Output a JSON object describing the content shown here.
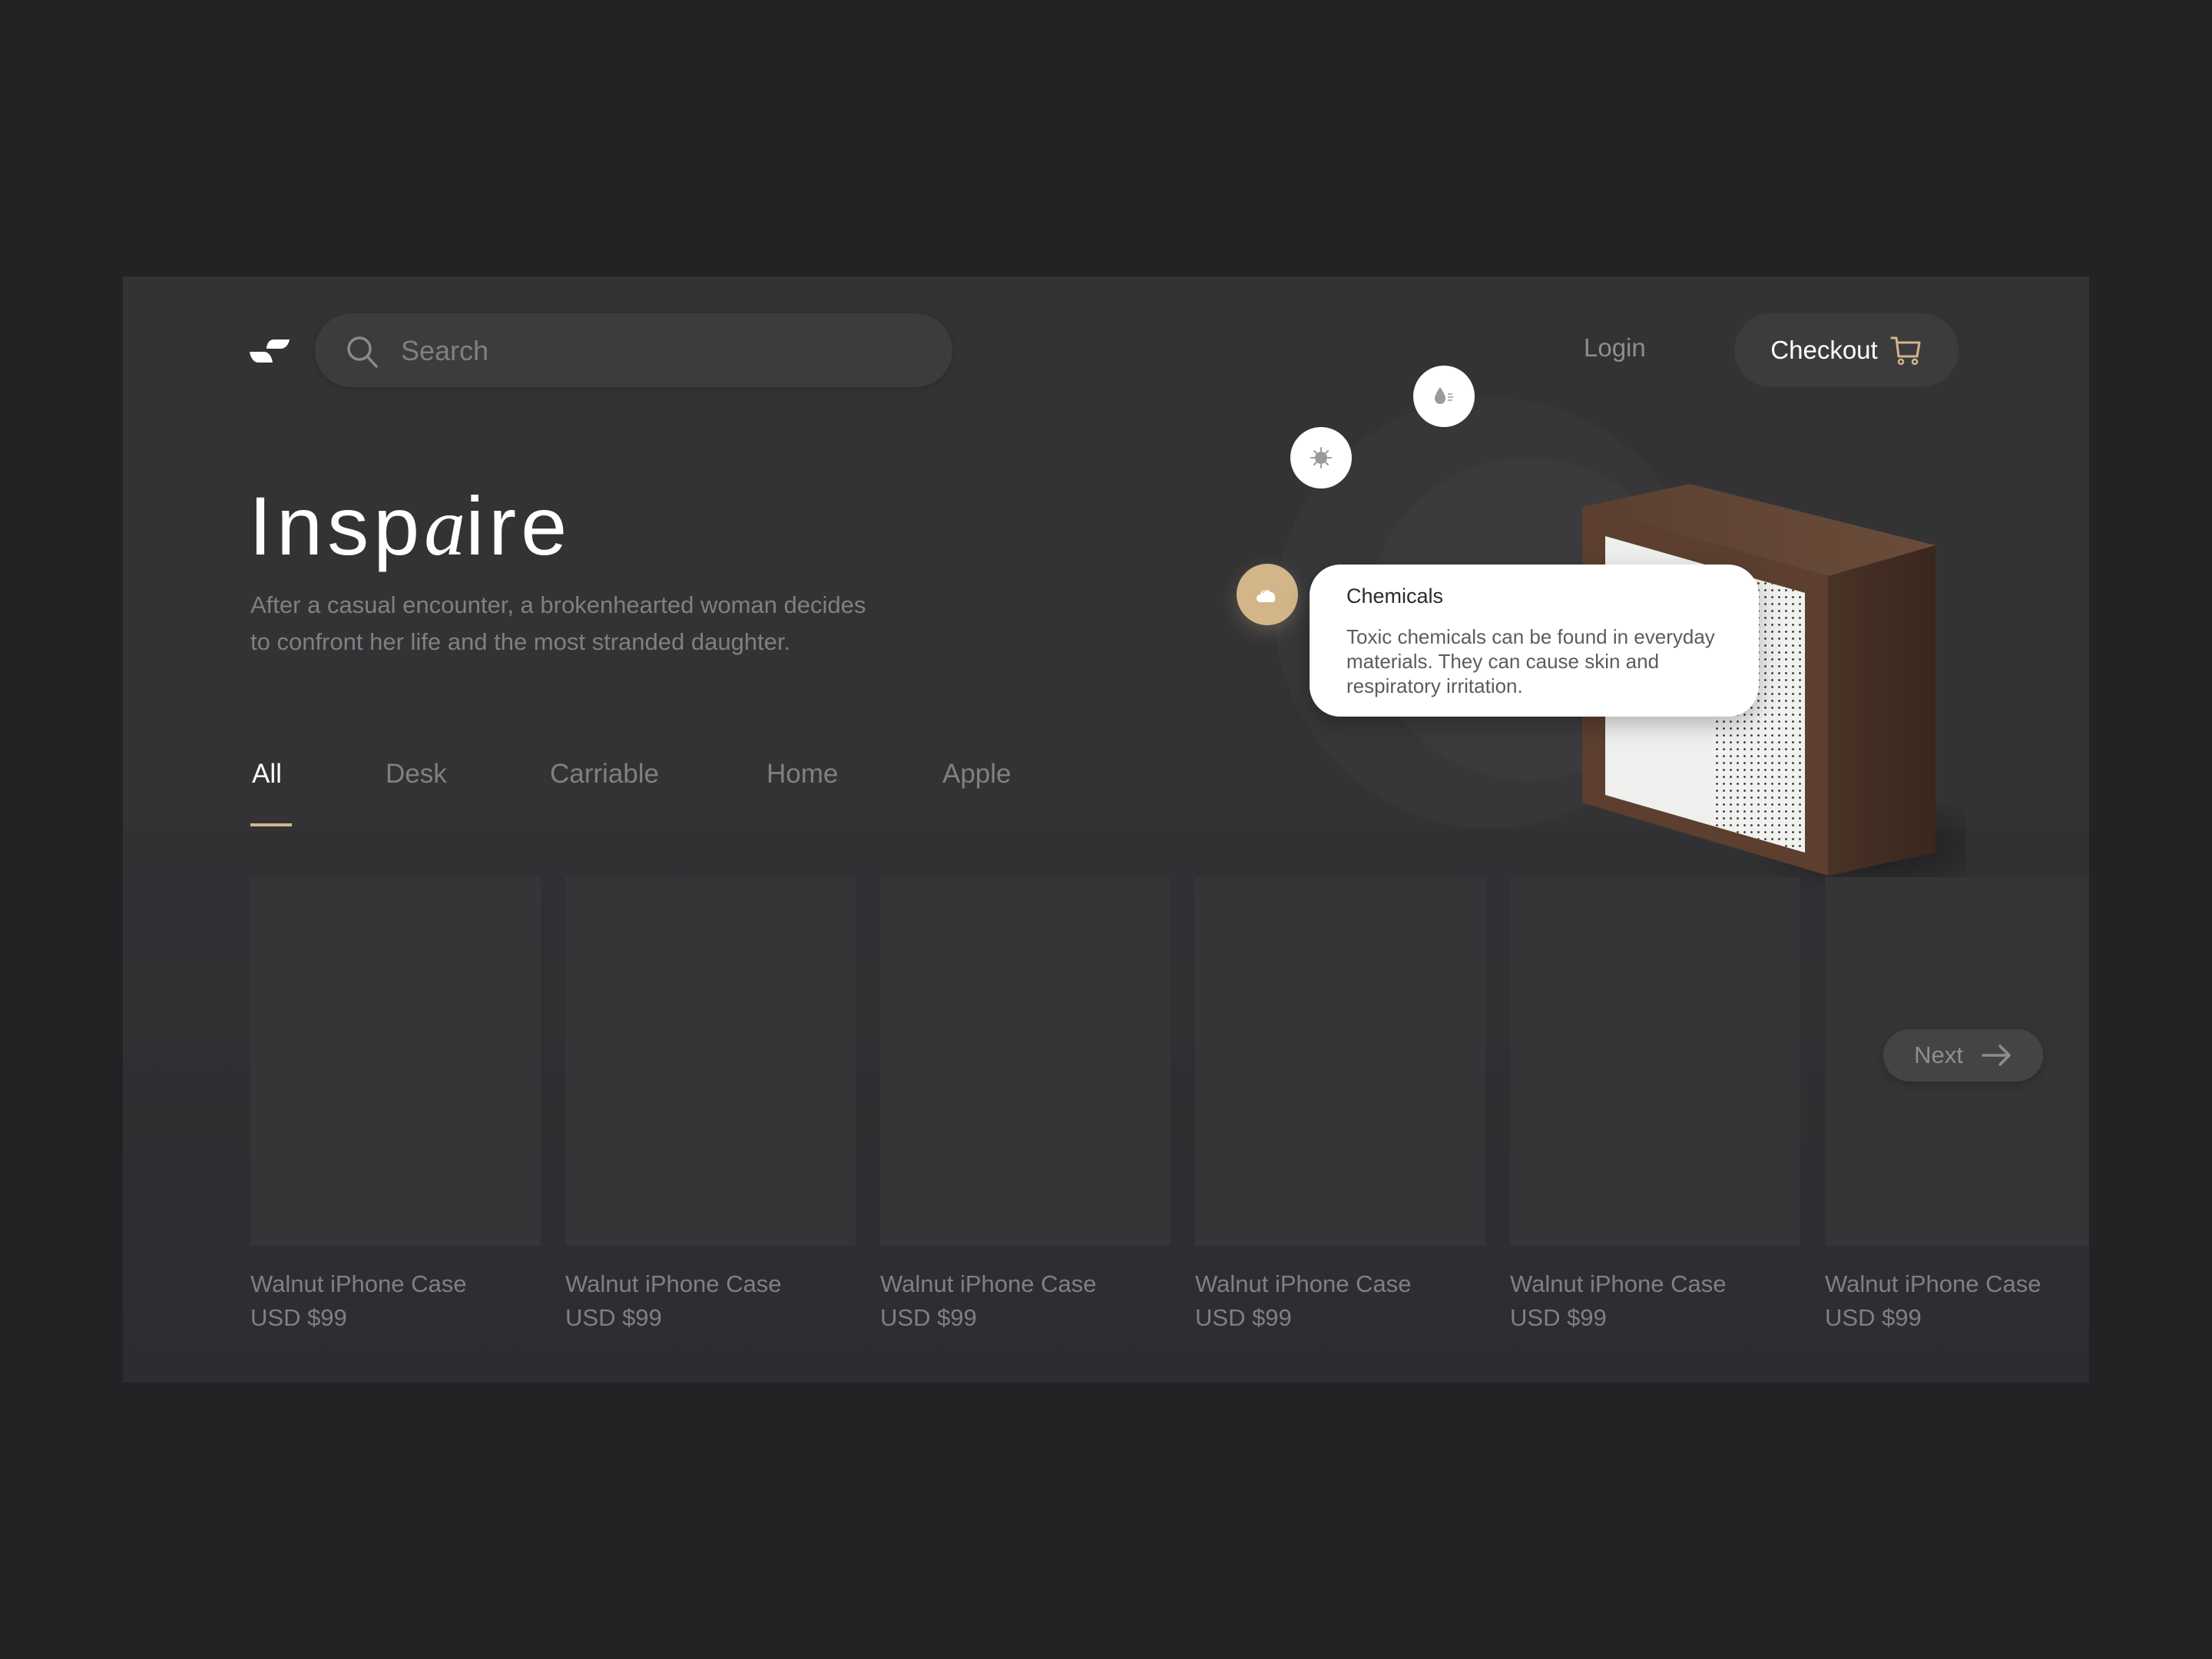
{
  "header": {
    "logo": "brand-logo",
    "search": {
      "placeholder": "Search",
      "value": "",
      "icon": "search-icon"
    },
    "login_label": "Login",
    "checkout_label": "Checkout",
    "checkout_icon": "cart-icon"
  },
  "hero": {
    "title_prefix": "Insp",
    "title_italic": "a",
    "title_suffix": "ire",
    "description_line1": "After a casual encounter, a brokenhearted woman decides",
    "description_line2": "to confront her life and the most stranded daughter."
  },
  "tabs": [
    {
      "label": "All",
      "active": true
    },
    {
      "label": "Desk",
      "active": false
    },
    {
      "label": "Carriable",
      "active": false
    },
    {
      "label": "Home",
      "active": false
    },
    {
      "label": "Apple",
      "active": false
    }
  ],
  "feature_icons": [
    {
      "icon": "humidity-icon",
      "active": false
    },
    {
      "icon": "virus-icon",
      "active": false
    },
    {
      "icon": "chemicals-cloud-icon",
      "active": true
    }
  ],
  "tooltip": {
    "title": "Chemicals",
    "body": "Toxic chemicals can be found in everyday materials. They can cause skin and respiratory irritation."
  },
  "products": [
    {
      "name": "Walnut iPhone Case",
      "price": "USD $99"
    },
    {
      "name": "Walnut iPhone Case",
      "price": "USD $99"
    },
    {
      "name": "Walnut iPhone Case",
      "price": "USD $99"
    },
    {
      "name": "Walnut iPhone Case",
      "price": "USD $99"
    },
    {
      "name": "Walnut iPhone Case",
      "price": "USD $99"
    },
    {
      "name": "Walnut iPhone Case",
      "price": "USD $99"
    }
  ],
  "next_label": "Next",
  "colors": {
    "accent": "#d2b68a",
    "background": "#232325",
    "panel": "#333335"
  }
}
